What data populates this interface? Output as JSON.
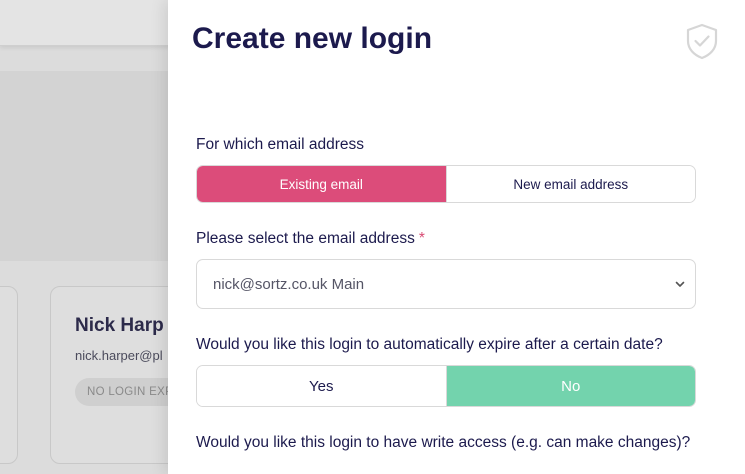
{
  "background": {
    "card": {
      "name": "Nick Harp",
      "email": "nick.harper@pl",
      "badge": "NO LOGIN EXP"
    }
  },
  "modal": {
    "title": "Create new login",
    "shield_icon": "shield-check-icon",
    "email_question": {
      "label": "For which email address",
      "options": [
        "Existing email",
        "New email address"
      ],
      "selected": "Existing email"
    },
    "select_email": {
      "label": "Please select the email address",
      "required_marker": "*",
      "value": "nick@sortz.co.uk Main"
    },
    "expire_question": {
      "label": "Would you like this login to automatically expire after a certain date?",
      "options": [
        "Yes",
        "No"
      ],
      "selected": "No"
    },
    "write_access_question": {
      "label": "Would you like this login to have write access (e.g. can make changes)?"
    }
  },
  "colors": {
    "accent_pink": "#dc4c7a",
    "accent_green": "#73d3ad",
    "title": "#1c1a4d"
  }
}
